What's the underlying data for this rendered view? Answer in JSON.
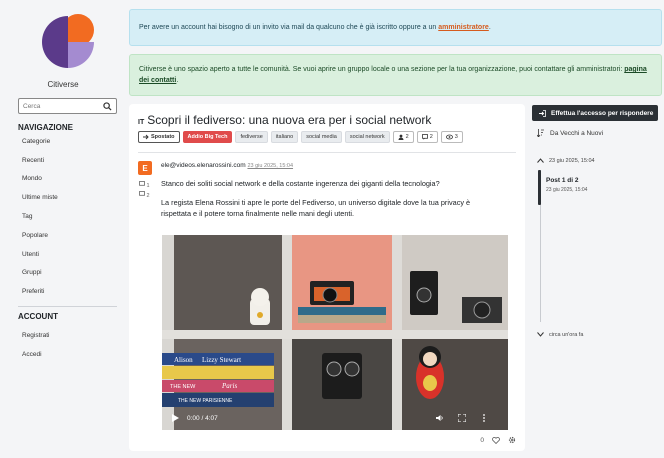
{
  "site": {
    "name": "Citiverse"
  },
  "search": {
    "placeholder": "Cerca"
  },
  "navigation": {
    "heading": "NAVIGAZIONE",
    "items": [
      "Categorie",
      "Recenti",
      "Mondo",
      "Ultime miste",
      "Tag",
      "Popolare",
      "Utenti",
      "Gruppi",
      "Preferiti"
    ]
  },
  "account": {
    "heading": "ACCOUNT",
    "items": [
      "Registrati",
      "Accedi"
    ]
  },
  "alerts": {
    "info_text": "Per avere un account hai bisogno di un invito via mail da qualcuno che è già iscritto oppure a un ",
    "info_link": "amministratore",
    "info_end": ".",
    "success_text": "Citiverse è uno spazio aperto a tutte le comunità. Se vuoi aprire un gruppo locale o una sezione per la tua organizzazione, puoi contattare gli amministratori: ",
    "success_link": "pagina dei contatti",
    "success_end": "."
  },
  "topic": {
    "language": "IT",
    "title": "Scopri il fediverso: una nuova era per i social network",
    "moved_label": "Spostato",
    "hot_label": "Addio Big Tech",
    "tags": [
      "fediverse",
      "italiano",
      "social media",
      "social network"
    ],
    "stats": {
      "posters": "2",
      "posts": "2",
      "views": "3"
    }
  },
  "post": {
    "avatar_letter": "E",
    "author": "ele@videos.elenarossini.com",
    "time": "23 giu 2025, 15:04",
    "reply_count": "1",
    "upvote_count": "2",
    "text1": "Stanco dei soliti social network e della costante ingerenza dei giganti della tecnologia?",
    "text2": "La regista Elena Rossini ti apre le porte del Fediverso, un universo digitale dove la tua privacy è rispettata e il potere torna finalmente nelle mani degli utenti.",
    "votes": "0"
  },
  "video": {
    "time": "0:00 / 4:07",
    "books": [
      "Alison",
      "Lizzy Stewart",
      "THE NEW",
      "Paris",
      "THE NEW PARISIENNE"
    ]
  },
  "sidebar_right": {
    "reply_button": "Effettua l'accesso per rispondere",
    "sort_label": "Da Vecchi a Nuovi",
    "timeline_start": "23 giu 2025, 15:04",
    "timeline_post": "Post 1 di 2",
    "timeline_post_date": "23 giu 2025, 15:04",
    "timeline_end": "circa un'ora fa"
  },
  "colors": {
    "accent": "#f26b21",
    "hot_tag": "#e04b4b",
    "dark_button": "#2b3035",
    "info_bg": "#d6eef6",
    "success_bg": "#daf0de"
  }
}
